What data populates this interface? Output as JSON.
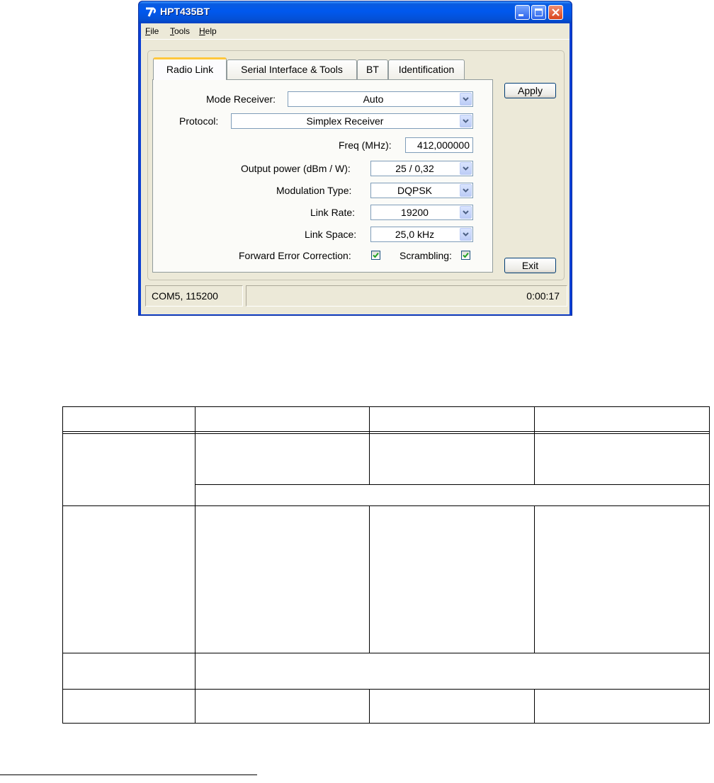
{
  "window": {
    "title": "HPT435BT",
    "menu": [
      {
        "label": "File",
        "accel": "F",
        "rest": "ile"
      },
      {
        "label": "Tools",
        "accel": "T",
        "rest": "ools"
      },
      {
        "label": "Help",
        "accel": "H",
        "rest": "elp"
      }
    ],
    "tabs": [
      {
        "label": "Radio Link",
        "active": true
      },
      {
        "label": "Serial Interface & Tools",
        "active": false
      },
      {
        "label": "BT",
        "active": false
      },
      {
        "label": "Identification",
        "active": false
      }
    ],
    "fields": {
      "mode_receiver": {
        "label": "Mode Receiver:",
        "value": "Auto"
      },
      "protocol": {
        "label": "Protocol:",
        "value": "Simplex Receiver"
      },
      "freq": {
        "label": "Freq (MHz):",
        "value": "412,000000"
      },
      "output_power": {
        "label": "Output power (dBm / W):",
        "value": "25 / 0,32"
      },
      "modulation_type": {
        "label": "Modulation Type:",
        "value": "DQPSK"
      },
      "link_rate": {
        "label": "Link Rate:",
        "value": "19200"
      },
      "link_space": {
        "label": "Link Space:",
        "value": "25,0 kHz"
      },
      "fec": {
        "label": "Forward Error Correction:",
        "checked": true
      },
      "scrambling": {
        "label": "Scrambling:",
        "checked": true
      }
    },
    "buttons": {
      "apply": "Apply",
      "exit": "Exit"
    },
    "status": {
      "port": "COM5, 115200",
      "middle": "",
      "elapsed": "0:00:17"
    }
  },
  "colors": {
    "titlebar": "#0058ee",
    "window_bg": "#ece9d8",
    "active_tab_accent": "#ffc73c",
    "check_mark": "#21a121",
    "close_button": "#d8441c"
  },
  "empty_table": {
    "rows": 8,
    "columns": 4,
    "cells": []
  }
}
